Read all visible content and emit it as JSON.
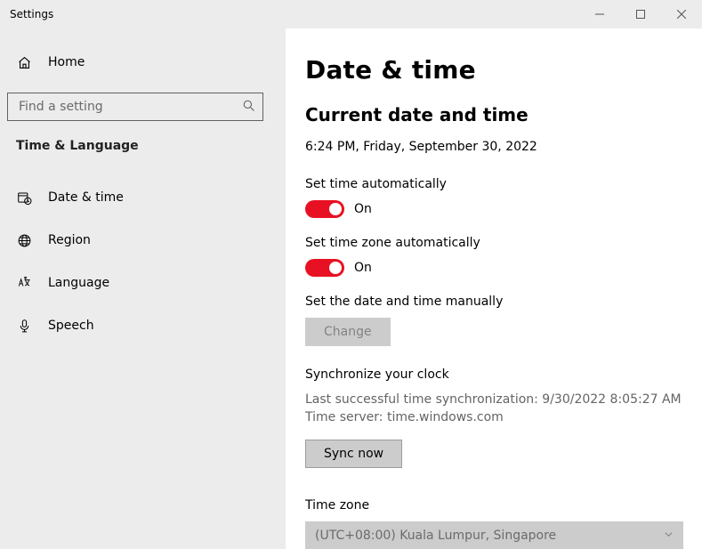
{
  "window": {
    "title": "Settings"
  },
  "sidebar": {
    "home_label": "Home",
    "search_placeholder": "Find a setting",
    "section_header": "Time & Language",
    "items": [
      {
        "label": "Date & time"
      },
      {
        "label": "Region"
      },
      {
        "label": "Language"
      },
      {
        "label": "Speech"
      }
    ]
  },
  "main": {
    "page_title": "Date & time",
    "current_section_title": "Current date and time",
    "current_value": "6:24 PM, Friday, September 30, 2022",
    "set_time_auto": {
      "label": "Set time automatically",
      "state": "On"
    },
    "set_tz_auto": {
      "label": "Set time zone automatically",
      "state": "On"
    },
    "manual": {
      "label": "Set the date and time manually",
      "button": "Change"
    },
    "sync": {
      "header": "Synchronize your clock",
      "last_line": "Last successful time synchronization: 9/30/2022 8:05:27 AM",
      "server_line": "Time server: time.windows.com",
      "button": "Sync now"
    },
    "timezone": {
      "label": "Time zone",
      "selected": "(UTC+08:00) Kuala Lumpur, Singapore"
    }
  },
  "colors": {
    "toggle_accent": "#e81123"
  }
}
